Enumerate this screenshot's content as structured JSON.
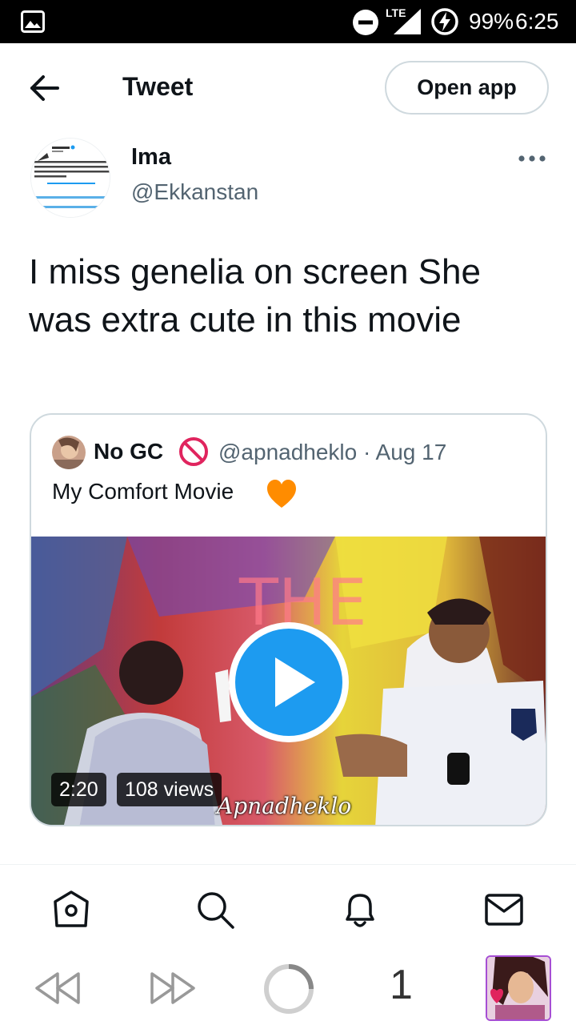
{
  "status_bar": {
    "network": "LTE",
    "battery": "99%",
    "time": "6:25"
  },
  "header": {
    "title": "Tweet",
    "open_app_label": "Open app"
  },
  "tweet": {
    "author_name": "Ima",
    "author_handle": "@Ekkanstan",
    "text": "I miss genelia on screen She was extra cute in this movie"
  },
  "quoted_tweet": {
    "author_name": "No GC",
    "meta": "@apnadheklo · Aug 17",
    "text": "My Comfort Movie",
    "video": {
      "duration": "2:20",
      "views": "108 views",
      "watermark": "Apnadheklo"
    }
  },
  "browser": {
    "tab_count": "1"
  },
  "colors": {
    "accent": "#1d9bf0",
    "text": "#0f1419",
    "muted": "#536471",
    "border": "#cfd9de",
    "heart": "#ff8c00",
    "no_entry": "#e0245e"
  },
  "icons": [
    "gallery-icon",
    "do-not-disturb-icon",
    "signal-icon",
    "battery-charging-icon",
    "back-arrow-icon",
    "more-icon",
    "no-entry-icon",
    "orange-heart-icon",
    "play-icon",
    "home-icon",
    "search-icon",
    "notifications-icon",
    "messages-icon",
    "rewind-icon",
    "fast-forward-icon",
    "loading-icon"
  ]
}
